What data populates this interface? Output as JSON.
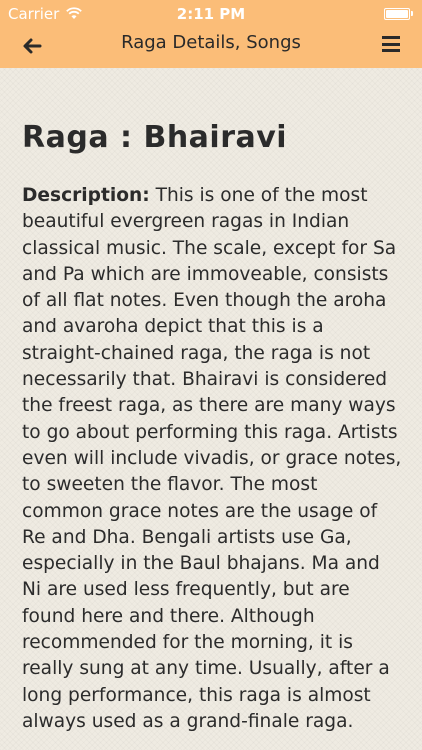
{
  "status_bar": {
    "carrier": "Carrier",
    "time": "2:11 PM",
    "wifi_icon": "wifi-icon",
    "battery_icon": "battery-icon"
  },
  "nav": {
    "title": "Raga Details, Songs",
    "back_icon": "back-arrow-icon",
    "menu_icon": "hamburger-menu-icon",
    "bar_color": "#fbbd78"
  },
  "raga": {
    "title": "Raga : Bhairavi",
    "description_label": "Description:",
    "description_text": " This is one of the most beautiful evergreen ragas in Indian classical music. The scale, except for Sa and Pa which are immoveable, consists of all flat notes. Even though the aroha and avaroha depict that this is a straight-chained raga, the raga is not necessarily that. Bhairavi is considered the freest raga, as there are many ways to go about performing this raga. Artists even will include vivadis, or grace notes, to sweeten the flavor. The most common grace notes are the usage of Re and Dha. Bengali artists use Ga, especially in the Baul bhajans. Ma and Ni are used less frequently, but are found here and there. Although recommended for the morning, it is really sung at any time. Usually, after a long performance, this raga is almost always used as a grand-finale raga."
  }
}
